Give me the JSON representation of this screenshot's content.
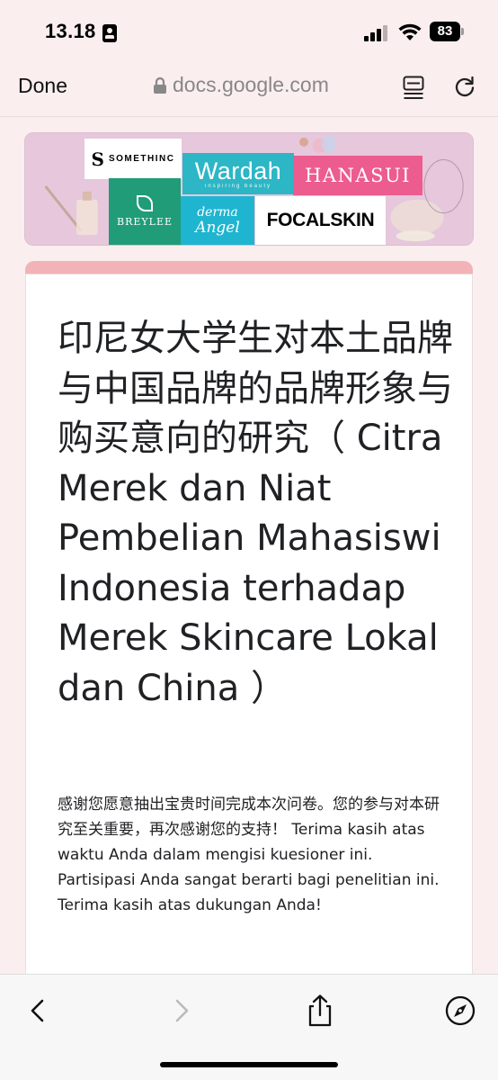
{
  "status_bar": {
    "time": "13.18",
    "battery": "83"
  },
  "browser": {
    "done_label": "Done",
    "url": "docs.google.com"
  },
  "banner": {
    "brands": {
      "somethinc_s": "S",
      "somethinc": "SOMETHINC",
      "wardah": "Wardah",
      "wardah_tagline": "inspiring beauty",
      "hanasui": "HANASUI",
      "breylee": "BREYLEE",
      "derma_1": "derma",
      "derma_2": "Angel",
      "focalskin": "FOCALSKIN"
    }
  },
  "form": {
    "title": "印尼女大学生对本土品牌与中国品牌的品牌形象与购买意向的研究（ Citra Merek dan Niat Pembelian Mahasiswi Indonesia terhadap Merek Skincare Lokal dan China ）",
    "description": "感谢您愿意抽出宝贵时间完成本次问卷。您的参与对本研究至关重要，再次感谢您的支持！ Terima kasih atas waktu Anda dalam mengisi kuesioner ini. Partisipasi Anda sangat berarti bagi penelitian ini. Terima kasih atas dukungan Anda!",
    "accent_color": "#f1b3b7"
  },
  "icons": {
    "status": [
      "person-badge-icon",
      "cellular-signal-icon",
      "wifi-icon",
      "battery-icon"
    ],
    "browser": [
      "lock-icon",
      "reader-icon",
      "reload-icon"
    ],
    "bottom": [
      "back-icon",
      "forward-icon",
      "share-icon",
      "compass-icon"
    ]
  }
}
